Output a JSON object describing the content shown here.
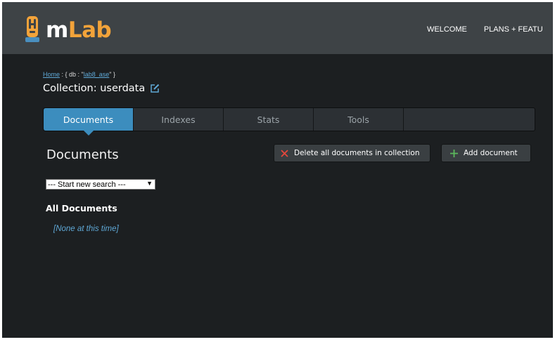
{
  "header": {
    "logo": {
      "icon": "mlab-bottle-icon",
      "text_m": "m",
      "text_lab": "Lab",
      "accent": "#f2a33a"
    },
    "nav": [
      "WELCOME",
      "PLANS + FEATU"
    ]
  },
  "breadcrumb": {
    "home": "Home",
    "sep1": " : { ",
    "db_label": "db",
    "sep2": " : \"",
    "db_name": "lab8_ase",
    "end": "\" }"
  },
  "collection": {
    "label": "Collection: userdata",
    "edit_icon": "edit-icon"
  },
  "tabs": [
    {
      "label": "Documents",
      "active": true
    },
    {
      "label": "Indexes"
    },
    {
      "label": "Stats"
    },
    {
      "label": "Tools"
    },
    {
      "label": ""
    }
  ],
  "documents": {
    "heading": "Documents",
    "delete_button": {
      "label": "Delete all documents in collection",
      "icon": "x-icon",
      "color": "#e8473c"
    },
    "add_button": {
      "label": "Add document",
      "icon": "plus-icon",
      "color": "#5cb85c"
    },
    "search_select": {
      "selected": "--- Start new search ---"
    },
    "all_heading": "All Documents",
    "empty_message": "[None at this time]"
  },
  "colors": {
    "tab_active": "#3c8dbe",
    "background": "#1c1f21",
    "topbar": "#3e4346",
    "link": "#5fa8d6"
  }
}
